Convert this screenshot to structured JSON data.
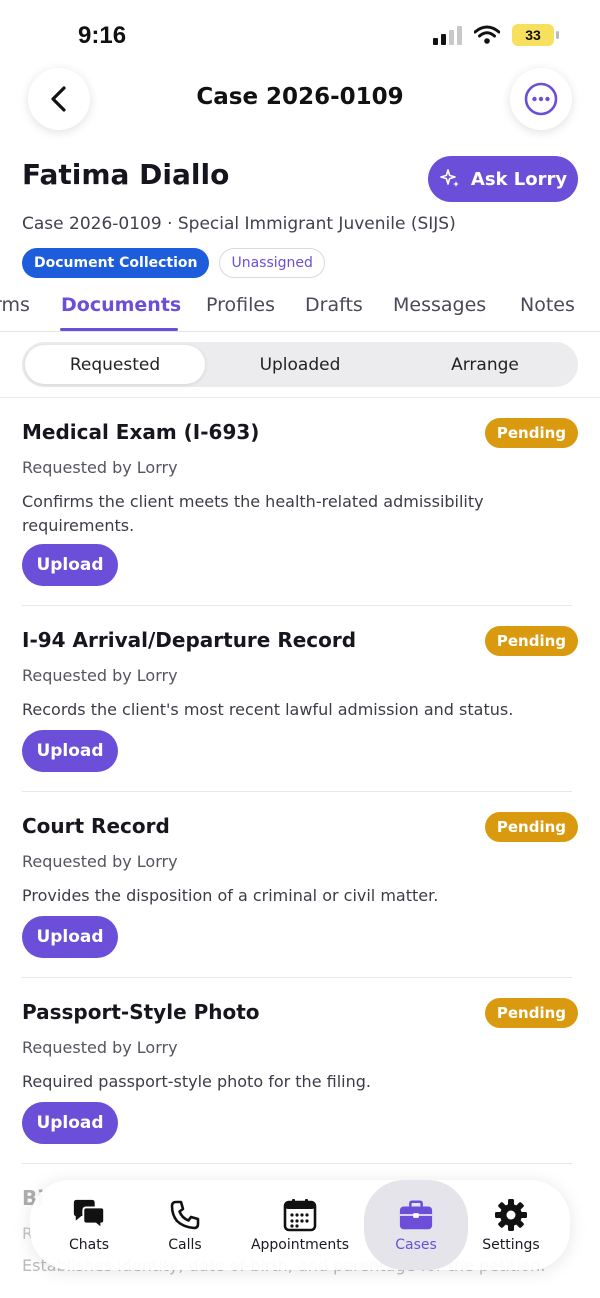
{
  "status": {
    "time": "9:16",
    "battery": "33"
  },
  "nav": {
    "title": "Case 2026-0109"
  },
  "client": {
    "name": "Fatima Diallo",
    "ask_label": "Ask Lorry",
    "subtitle": "Case 2026-0109 · Special Immigrant Juvenile (SIJS)",
    "badge_stage": "Document Collection",
    "badge_assignee": "Unassigned"
  },
  "tabs": [
    {
      "label": "rms"
    },
    {
      "label": "Documents"
    },
    {
      "label": "Profiles"
    },
    {
      "label": "Drafts"
    },
    {
      "label": "Messages"
    },
    {
      "label": "Notes"
    }
  ],
  "segments": [
    {
      "label": "Requested"
    },
    {
      "label": "Uploaded"
    },
    {
      "label": "Arrange"
    }
  ],
  "documents": [
    {
      "title": "Medical Exam (I-693)",
      "status": "Pending",
      "requested_by": "Requested by Lorry",
      "description": "Confirms the client meets the health-related admissibility requirements.",
      "action": "Upload"
    },
    {
      "title": "I-94 Arrival/Departure Record",
      "status": "Pending",
      "requested_by": "Requested by Lorry",
      "description": "Records the client's most recent lawful admission and status.",
      "action": "Upload"
    },
    {
      "title": "Court Record",
      "status": "Pending",
      "requested_by": "Requested by Lorry",
      "description": "Provides the disposition of a criminal or civil matter.",
      "action": "Upload"
    },
    {
      "title": "Passport-Style Photo",
      "status": "Pending",
      "requested_by": "Requested by Lorry",
      "description": "Required passport-style photo for the filing.",
      "action": "Upload"
    }
  ],
  "partial_document": {
    "title": "Bi",
    "requested_by": "R",
    "description": "Establishes identity, date of birth, and parentage for the petition."
  },
  "tabbar": [
    {
      "label": "Chats",
      "icon": "chat-bubbles-icon"
    },
    {
      "label": "Calls",
      "icon": "phone-icon"
    },
    {
      "label": "Appointments",
      "icon": "calendar-icon"
    },
    {
      "label": "Cases",
      "icon": "briefcase-icon"
    },
    {
      "label": "Settings",
      "icon": "gear-icon"
    }
  ],
  "colors": {
    "accent": "#6b4fd8",
    "stage_badge": "#1d5ddb",
    "pending": "#d99a0f"
  }
}
